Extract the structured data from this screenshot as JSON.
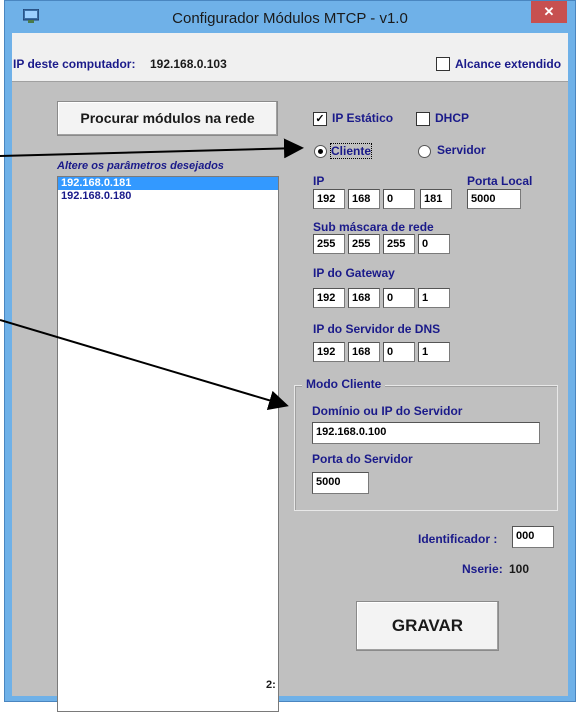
{
  "window": {
    "title": "Configurador Módulos MTCP - v1.0",
    "close_glyph": "✕"
  },
  "header": {
    "ip_label": "IP deste computador:",
    "ip_value": "192.168.0.103",
    "extended_range_label": "Alcance extendido",
    "extended_range_checked": false
  },
  "left": {
    "search_button": "Procurar módulos na rede",
    "list_label": "Altere os parâmetros desejados",
    "modules": [
      {
        "ip": "192.168.0.181",
        "selected": true
      },
      {
        "ip": "192.168.0.180",
        "selected": false
      }
    ],
    "count_label": "2:"
  },
  "network": {
    "static_ip_label": "IP Estático",
    "static_ip_checked": true,
    "dhcp_label": "DHCP",
    "dhcp_checked": false,
    "client_label": "Cliente",
    "client_selected": true,
    "server_label": "Servidor",
    "server_selected": false,
    "ip_label": "IP",
    "ip": [
      "192",
      "168",
      "0",
      "181"
    ],
    "local_port_label": "Porta Local",
    "local_port": "5000",
    "subnet_label": "Sub máscara de rede",
    "subnet": [
      "255",
      "255",
      "255",
      "0"
    ],
    "gateway_label": "IP do Gateway",
    "gateway": [
      "192",
      "168",
      "0",
      "1"
    ],
    "dns_label": "IP do Servidor de DNS",
    "dns": [
      "192",
      "168",
      "0",
      "1"
    ]
  },
  "client_mode": {
    "title": "Modo Cliente",
    "server_domain_label": "Domínio ou IP do Servidor",
    "server_domain": "192.168.0.100",
    "server_port_label": "Porta do Servidor",
    "server_port": "5000"
  },
  "footer": {
    "identifier_label": "Identificador :",
    "identifier": "000",
    "nserie_label": "Nserie:",
    "nserie": "100",
    "save_button": "GRAVAR"
  },
  "colors": {
    "title_bar": "#6fb1e8",
    "panel": "#c0c0c0",
    "label_blue": "#1a1a8a",
    "selection": "#3399ff",
    "close_red": "#c75050"
  }
}
